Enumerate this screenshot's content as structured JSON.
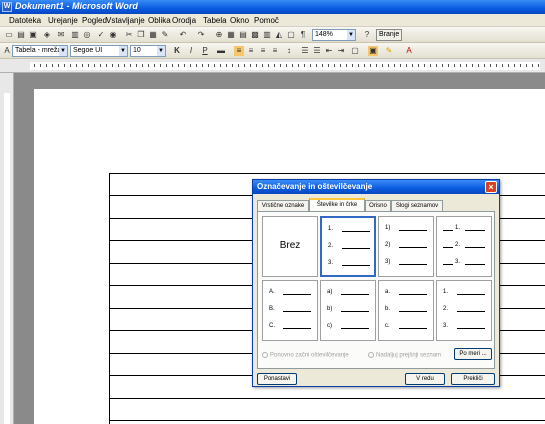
{
  "window": {
    "title": "Dokument1 - Microsoft Word"
  },
  "menu": [
    "Datoteka",
    "Urejanje",
    "Pogled",
    "Vstavljanje",
    "Oblika",
    "Orodja",
    "Tabela",
    "Okno",
    "Pomoč"
  ],
  "toolbar": {
    "zoom": "148%",
    "read_label": "Branje",
    "style": "Tabela - mreža",
    "font": "Segoe UI",
    "size": "10"
  },
  "dialog": {
    "title": "Označevanje in oštevilčevanje",
    "tabs": [
      "Vrstične oznake",
      "Številke in črke",
      "Orisno",
      "Slogi seznamov"
    ],
    "none_label": "Brez",
    "styles": [
      [
        "1.",
        "2.",
        "3."
      ],
      [
        "1)",
        "2)",
        "3)"
      ],
      [
        "1.",
        "2.",
        "3."
      ],
      [
        "A.",
        "B.",
        "C."
      ],
      [
        "a)",
        "b)",
        "c)"
      ],
      [
        "a.",
        "b.",
        "c."
      ],
      [
        "1.",
        "2.",
        "3."
      ]
    ],
    "radio_restart": "Ponovno začni oštevilčevanje",
    "radio_continue": "Nadaljuj prejšnji seznam",
    "customize": "Po meri ...",
    "reset": "Ponastavi",
    "ok": "V redu",
    "cancel": "Prekliči"
  }
}
